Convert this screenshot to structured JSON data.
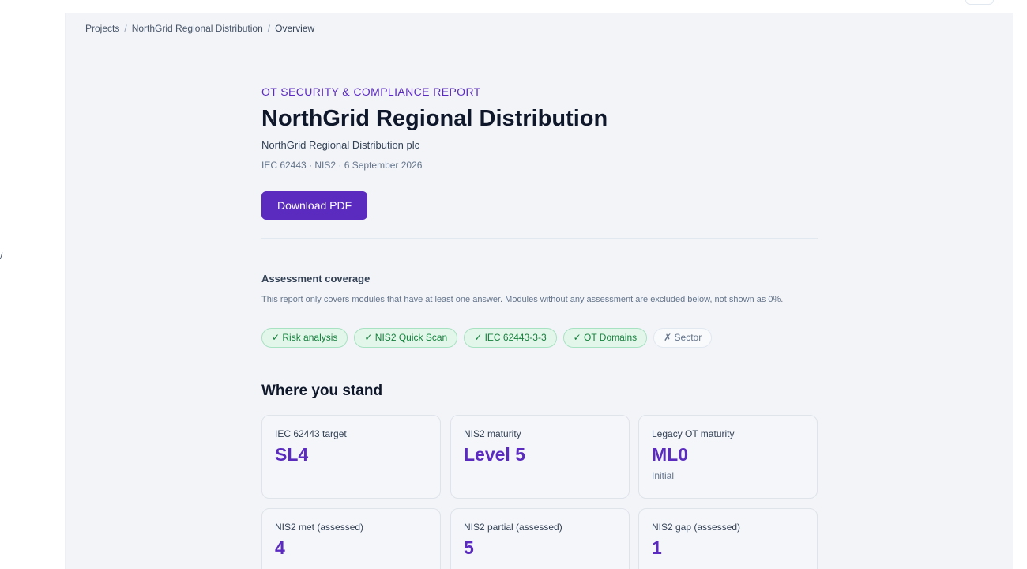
{
  "breadcrumb": {
    "items": [
      "Projects",
      "NorthGrid Regional Distribution",
      "Overview"
    ],
    "separator": "/"
  },
  "sidebar": {
    "fragment": "/"
  },
  "report": {
    "eyebrow": "OT SECURITY & COMPLIANCE REPORT",
    "title": "NorthGrid Regional Distribution",
    "organization": "NorthGrid Regional Distribution plc",
    "meta": "IEC 62443 · NIS2 · 6 September 2026",
    "download_label": "Download PDF"
  },
  "coverage": {
    "title": "Assessment coverage",
    "description": "This report only covers modules that have at least one answer. Modules without any assessment are excluded below, not shown as 0%.",
    "chips": [
      {
        "label": "✓ Risk analysis",
        "included": true
      },
      {
        "label": "✓ NIS2 Quick Scan",
        "included": true
      },
      {
        "label": "✓ IEC 62443-3-3",
        "included": true
      },
      {
        "label": "✓ OT Domains",
        "included": true
      },
      {
        "label": "✗ Sector",
        "included": false
      }
    ]
  },
  "standing": {
    "title": "Where you stand",
    "cards": [
      {
        "label": "IEC 62443 target",
        "value": "SL4",
        "sub": ""
      },
      {
        "label": "NIS2 maturity",
        "value": "Level 5",
        "sub": ""
      },
      {
        "label": "Legacy OT maturity",
        "value": "ML0",
        "sub": "Initial"
      },
      {
        "label": "NIS2 met (assessed)",
        "value": "4",
        "sub": ""
      },
      {
        "label": "NIS2 partial (assessed)",
        "value": "5",
        "sub": ""
      },
      {
        "label": "NIS2 gap (assessed)",
        "value": "1",
        "sub": ""
      }
    ]
  },
  "colors": {
    "accent": "#5b2bbf",
    "chip_included_bg": "#e3f6ea",
    "chip_included_text": "#15803d",
    "page_bg": "#f2f4f8"
  }
}
